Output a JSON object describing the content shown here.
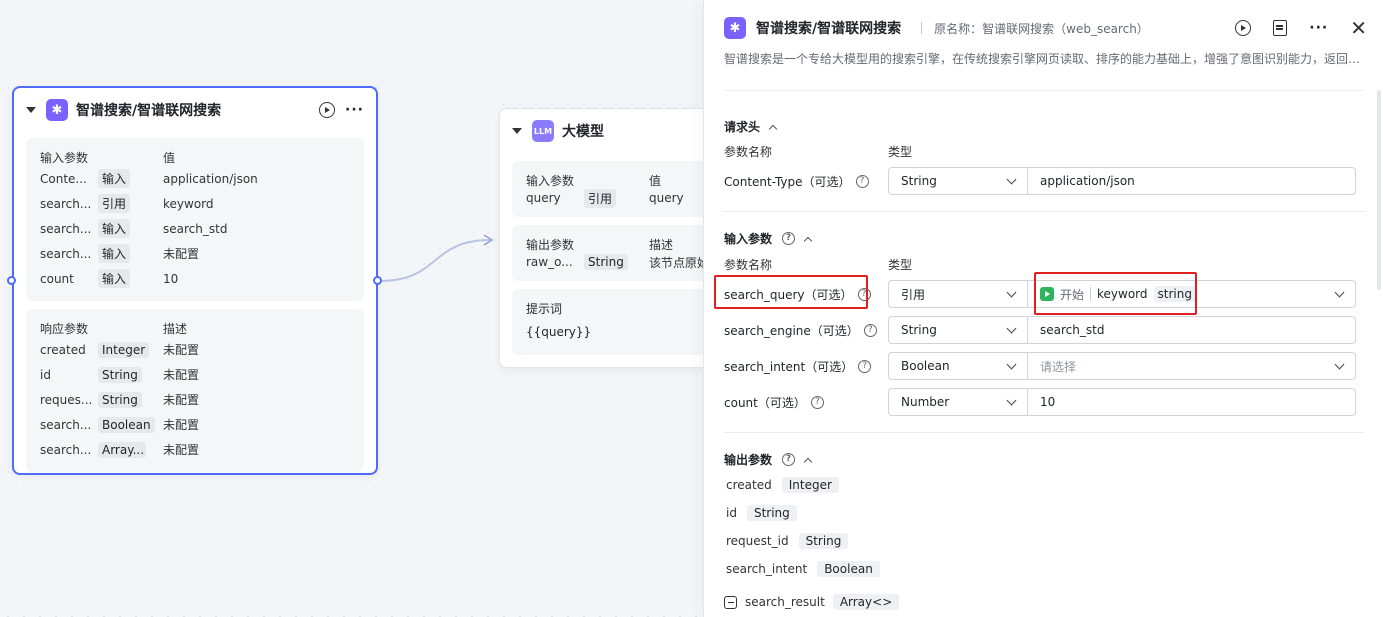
{
  "canvas": {
    "search_node": {
      "title": "智谱搜索/智谱联网搜索",
      "input_header": {
        "name": "输入参数",
        "value": "值"
      },
      "inputs": [
        {
          "name": "Conte...",
          "mode": "输入",
          "value": "application/json"
        },
        {
          "name": "search...",
          "mode": "引用",
          "value": "keyword"
        },
        {
          "name": "search...",
          "mode": "输入",
          "value": "search_std"
        },
        {
          "name": "search...",
          "mode": "输入",
          "value": "未配置"
        },
        {
          "name": "count",
          "mode": "输入",
          "value": "10"
        }
      ],
      "output_header": {
        "name": "响应参数",
        "desc": "描述"
      },
      "outputs": [
        {
          "name": "created",
          "type": "Integer",
          "desc": "未配置"
        },
        {
          "name": "id",
          "type": "String",
          "desc": "未配置"
        },
        {
          "name": "reques...",
          "type": "String",
          "desc": "未配置"
        },
        {
          "name": "search...",
          "type": "Boolean",
          "desc": "未配置"
        },
        {
          "name": "search...",
          "type": "Array...",
          "desc": "未配置"
        }
      ]
    },
    "llm_node": {
      "icon_text": "LLM",
      "title": "大模型",
      "input_header": {
        "name": "输入参数",
        "value": "值"
      },
      "input": {
        "name": "query",
        "mode": "引用",
        "value": "query"
      },
      "output_header": {
        "name": "输出参数",
        "desc": "描述"
      },
      "output": {
        "name": "raw_o...",
        "type": "String",
        "desc": "该节点原始"
      },
      "prompt_label": "提示词",
      "prompt_value": "{{query}}"
    }
  },
  "panel": {
    "title": "智谱搜索/智谱联网搜索",
    "original_name": "原名称：智谱联网搜索（web_search）",
    "description": "智谱搜索是一个专给大模型用的搜索引擎，在传统搜索引擎网页读取、排序的能力基础上，增强了意图识别能力，返回…",
    "headers_section": {
      "title": "请求头",
      "col_name": "参数名称",
      "col_type": "类型",
      "rows": [
        {
          "name": "Content-Type（可选）",
          "type": "String",
          "value": "application/json"
        }
      ]
    },
    "inputs_section": {
      "title": "输入参数",
      "col_name": "参数名称",
      "col_type": "类型",
      "rows": [
        {
          "name": "search_query（可选）",
          "type": "引用",
          "ref_source": "开始",
          "ref_var": "keyword",
          "ref_type": "string"
        },
        {
          "name": "search_engine（可选）",
          "type": "String",
          "value": "search_std"
        },
        {
          "name": "search_intent（可选）",
          "type": "Boolean",
          "placeholder": "请选择"
        },
        {
          "name": "count（可选）",
          "type": "Number",
          "value": "10"
        }
      ]
    },
    "outputs_section": {
      "title": "输出参数",
      "rows": [
        {
          "name": "created",
          "type": "Integer"
        },
        {
          "name": "id",
          "type": "String"
        },
        {
          "name": "request_id",
          "type": "String"
        },
        {
          "name": "search_intent",
          "type": "Boolean"
        },
        {
          "name": "search_result",
          "type": "Array<>"
        }
      ]
    }
  },
  "colors": {
    "accent": "#4d6bfe",
    "plugin_icon": "#7b61ff",
    "highlight": "#e02020",
    "start_green": "#2db55d"
  }
}
